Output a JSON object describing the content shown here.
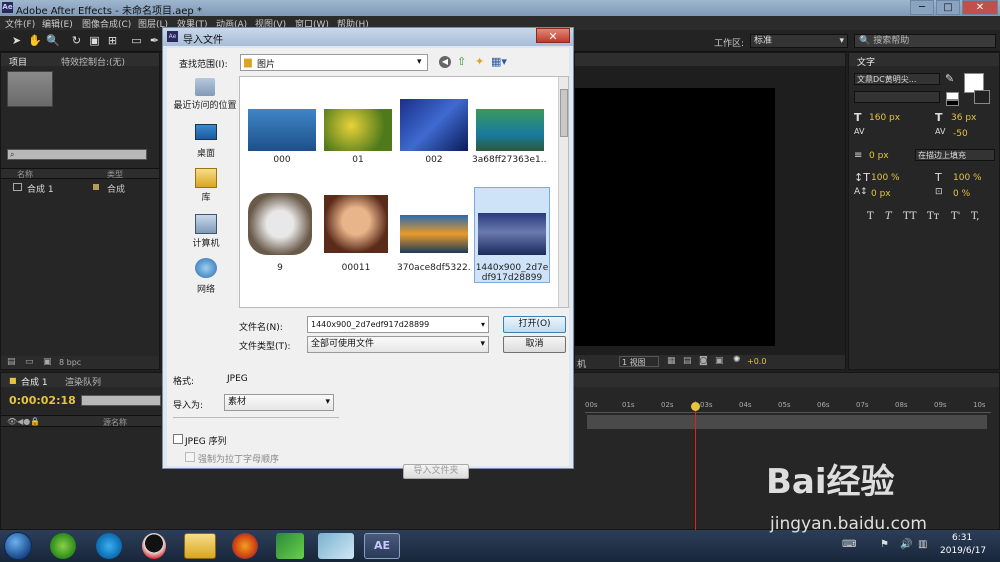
{
  "window": {
    "title": "Adobe After Effects - 未命名项目.aep *",
    "minimize": "─",
    "restore": "□",
    "close": "✕"
  },
  "menu": [
    "文件(F)",
    "编辑(E)",
    "图像合成(C)",
    "图层(L)",
    "效果(T)",
    "动画(A)",
    "视图(V)",
    "窗口(W)",
    "帮助(H)"
  ],
  "toolbar": {
    "workspace_label": "工作区:",
    "workspace_value": "标准",
    "search_placeholder": "搜索帮助"
  },
  "project": {
    "tab_project": "项目",
    "tab_effects": "特效控制台:(无)",
    "col_name": "名称",
    "col_type": "类型",
    "item_name": "合成 1",
    "item_type": "合成",
    "bpc": "8 bpc"
  },
  "viewer": {
    "view_label": "1 视图",
    "offset": "+0.0",
    "mode": "机"
  },
  "character": {
    "tab": "文字",
    "font": "文鼎DC黄明尖...",
    "font_size": "160 px",
    "leading": "36 px",
    "tracking_left": "",
    "tracking": "-50",
    "stroke_width": "0 px",
    "stroke_mode": "在描边上填充",
    "vscale": "100 %",
    "hscale": "100 %",
    "baseline": "0 px",
    "tsume": "0 %",
    "styles": [
      "T",
      "T",
      "TT",
      "Tт",
      "T'",
      "T,"
    ]
  },
  "timeline": {
    "tab_comp": "合成 1",
    "tab_render": "渲染队列",
    "timecode": "0:00:02:18",
    "layer_col": "源名称",
    "ruler": [
      "00s",
      "01s",
      "02s",
      "03s",
      "04s",
      "05s",
      "06s",
      "07s",
      "08s",
      "09s",
      "10s"
    ]
  },
  "dialog": {
    "title": "导入文件",
    "look_in_label": "查找范围(I):",
    "look_in_value": "图片",
    "places": [
      "最近访问的位置",
      "桌面",
      "库",
      "计算机",
      "网络"
    ],
    "files": [
      {
        "name": "000"
      },
      {
        "name": "01"
      },
      {
        "name": "002"
      },
      {
        "name": "3a68ff27363e1..."
      },
      {
        "name": "9"
      },
      {
        "name": "00011"
      },
      {
        "name": "370ace8df5322..."
      },
      {
        "name": "1440x900_2d7edf917d28899"
      }
    ],
    "filename_label": "文件名(N):",
    "filename_value": "1440x900_2d7edf917d28899",
    "filetype_label": "文件类型(T):",
    "filetype_value": "全部可使用文件",
    "open_button": "打开(O)",
    "cancel_button": "取消",
    "format_label": "格式:",
    "format_value": "JPEG",
    "import_as_label": "导入为:",
    "import_as_value": "素材",
    "sequence_label": "JPEG 序列",
    "alpha_label": "强制为拉丁字母顺序",
    "import_folder_button": "导入文件夹"
  },
  "taskbar": {
    "time": "6:31",
    "date": "2019/6/17",
    "ae_label": "AE"
  },
  "watermark": {
    "brand": "Bai经验",
    "url": "jingyan.baidu.com"
  }
}
